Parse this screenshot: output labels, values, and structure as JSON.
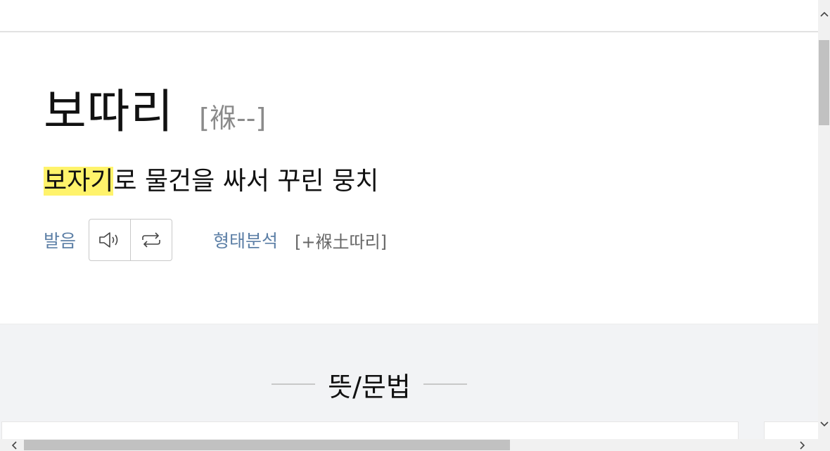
{
  "entry": {
    "headword": "보따리",
    "hanja": "[褓--]",
    "definition": {
      "highlighted": "보자기",
      "rest": "로 물건을 싸서 꾸린 뭉치"
    },
    "pronunciation": {
      "label": "발음",
      "play_icon": "speaker-icon",
      "repeat_icon": "repeat-icon"
    },
    "morphology": {
      "label": "형태분석",
      "value": "[+褓土따리]"
    }
  },
  "section": {
    "title": "뜻/문법"
  },
  "colors": {
    "highlight": "#fff36b",
    "link_blue": "#5c7fa6",
    "section_bg": "#f2f3f5"
  }
}
